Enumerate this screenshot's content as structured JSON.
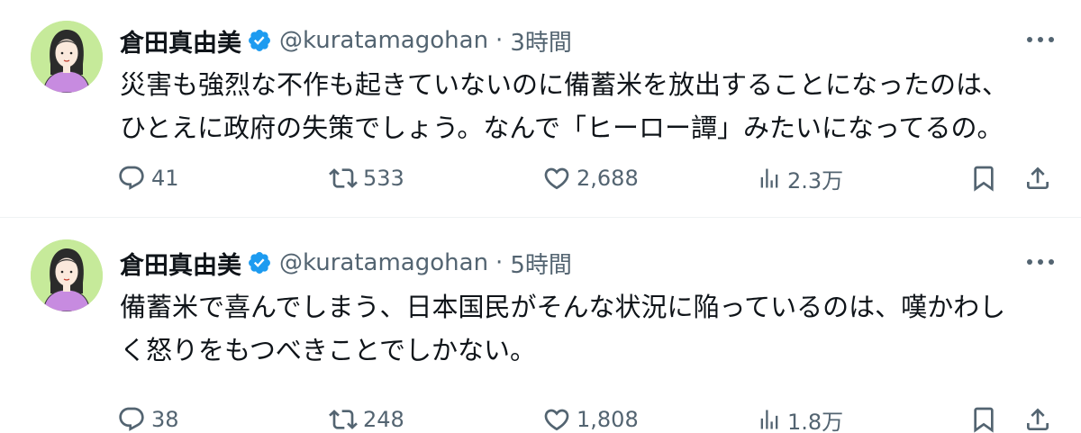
{
  "tweets": [
    {
      "author": {
        "name": "倉田真由美",
        "handle": "@kuratamagohan",
        "verified": true
      },
      "separator": "·",
      "time": "3時間",
      "text_lines": [
        "災害も強烈な不作も起きていないのに備蓄米を放出することになったのは、",
        "ひとえに政府の失策でしょう。なんで「ヒーロー譚」みたいになってるの。"
      ],
      "stats": {
        "replies": "41",
        "reposts": "533",
        "likes": "2,688",
        "views": "2.3万"
      }
    },
    {
      "author": {
        "name": "倉田真由美",
        "handle": "@kuratamagohan",
        "verified": true
      },
      "separator": "·",
      "time": "5時間",
      "text_lines": [
        "備蓄米で喜んでしまう、日本国民がそんな状況に陥っているのは、嘆かわし",
        "く怒りをもつべきことでしかない。"
      ],
      "stats": {
        "replies": "38",
        "reposts": "248",
        "likes": "1,808",
        "views": "1.8万"
      }
    }
  ],
  "icons": {
    "verified": "verified-badge-icon",
    "more": "more-dots-icon",
    "reply": "reply-bubble-icon",
    "repost": "repost-arrows-icon",
    "like": "heart-icon",
    "views": "views-bar-icon",
    "bookmark": "bookmark-icon",
    "share": "share-icon"
  },
  "colors": {
    "text": "#0f1419",
    "secondary": "#536471",
    "verified": "#1d9bf0",
    "divider": "#eff3f4",
    "avatar_bg": "#c6ea9a"
  }
}
